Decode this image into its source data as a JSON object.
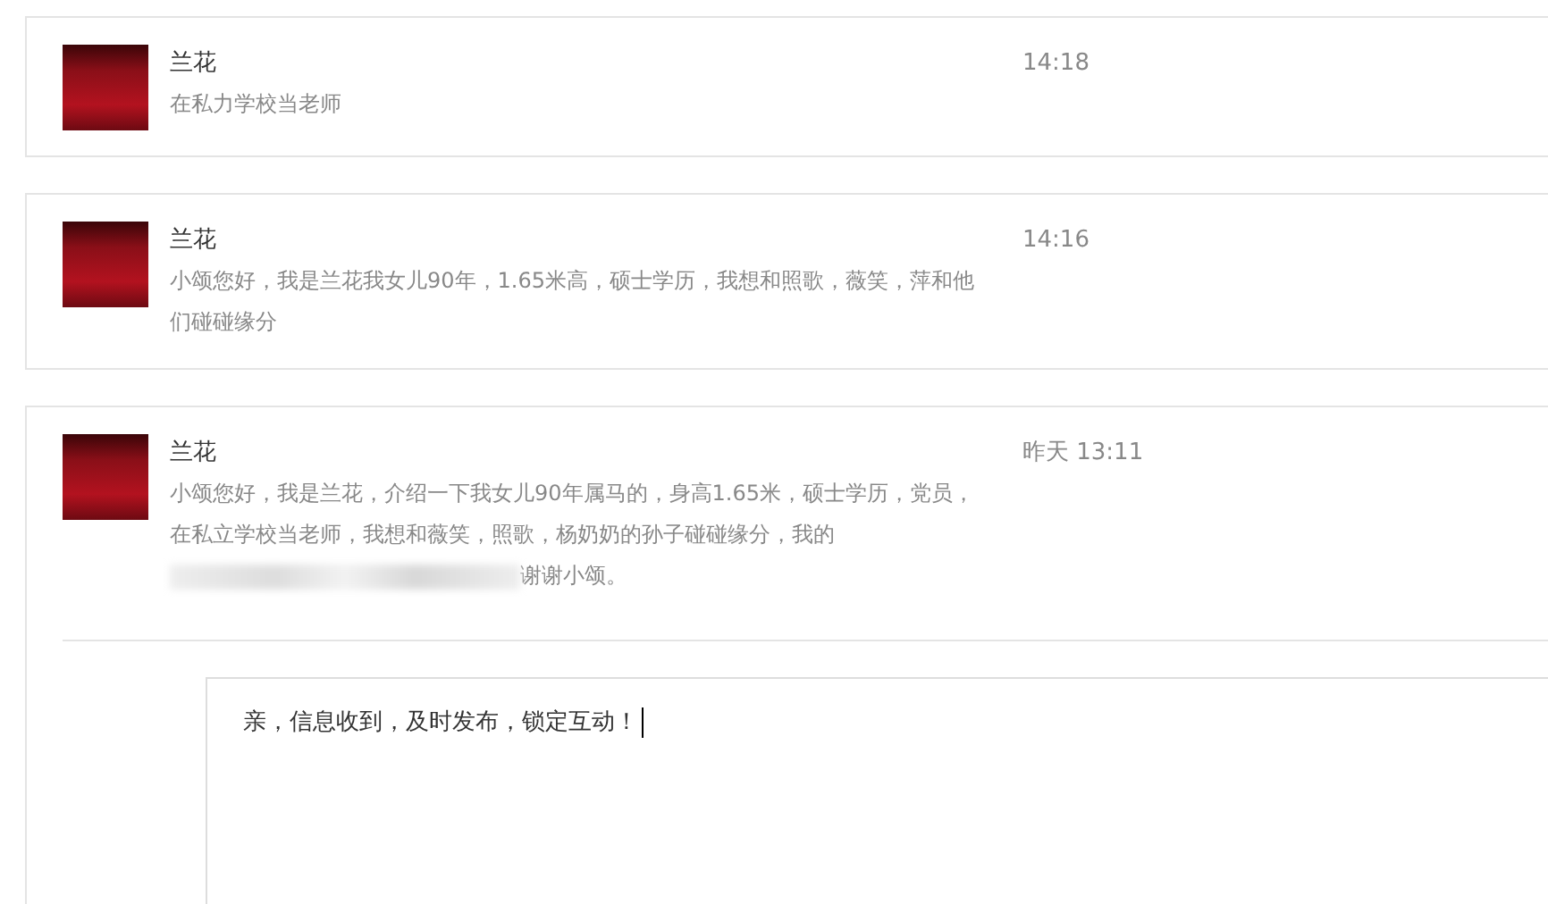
{
  "messages": [
    {
      "sender": "兰花",
      "text": "在私力学校当老师",
      "time": "14:18"
    },
    {
      "sender": "兰花",
      "text": "小颂您好，我是兰花我女儿90年，1.65米高，硕士学历，我想和照歌，薇笑，萍和他们碰碰缘分",
      "time": "14:16"
    },
    {
      "sender": "兰花",
      "text": "小颂您好，我是兰花，介绍一下我女儿90年属马的，身高1.65米，硕士学历，党员，在私立学校当老师，我想和薇笑，照歌，杨奶奶的孙子碰碰缘分，我的",
      "redacted": true,
      "text_after": "谢谢小颂。",
      "time": "昨天 13:11",
      "reply": {
        "value": "亲，信息收到，及时发布，锁定互动！"
      }
    }
  ]
}
